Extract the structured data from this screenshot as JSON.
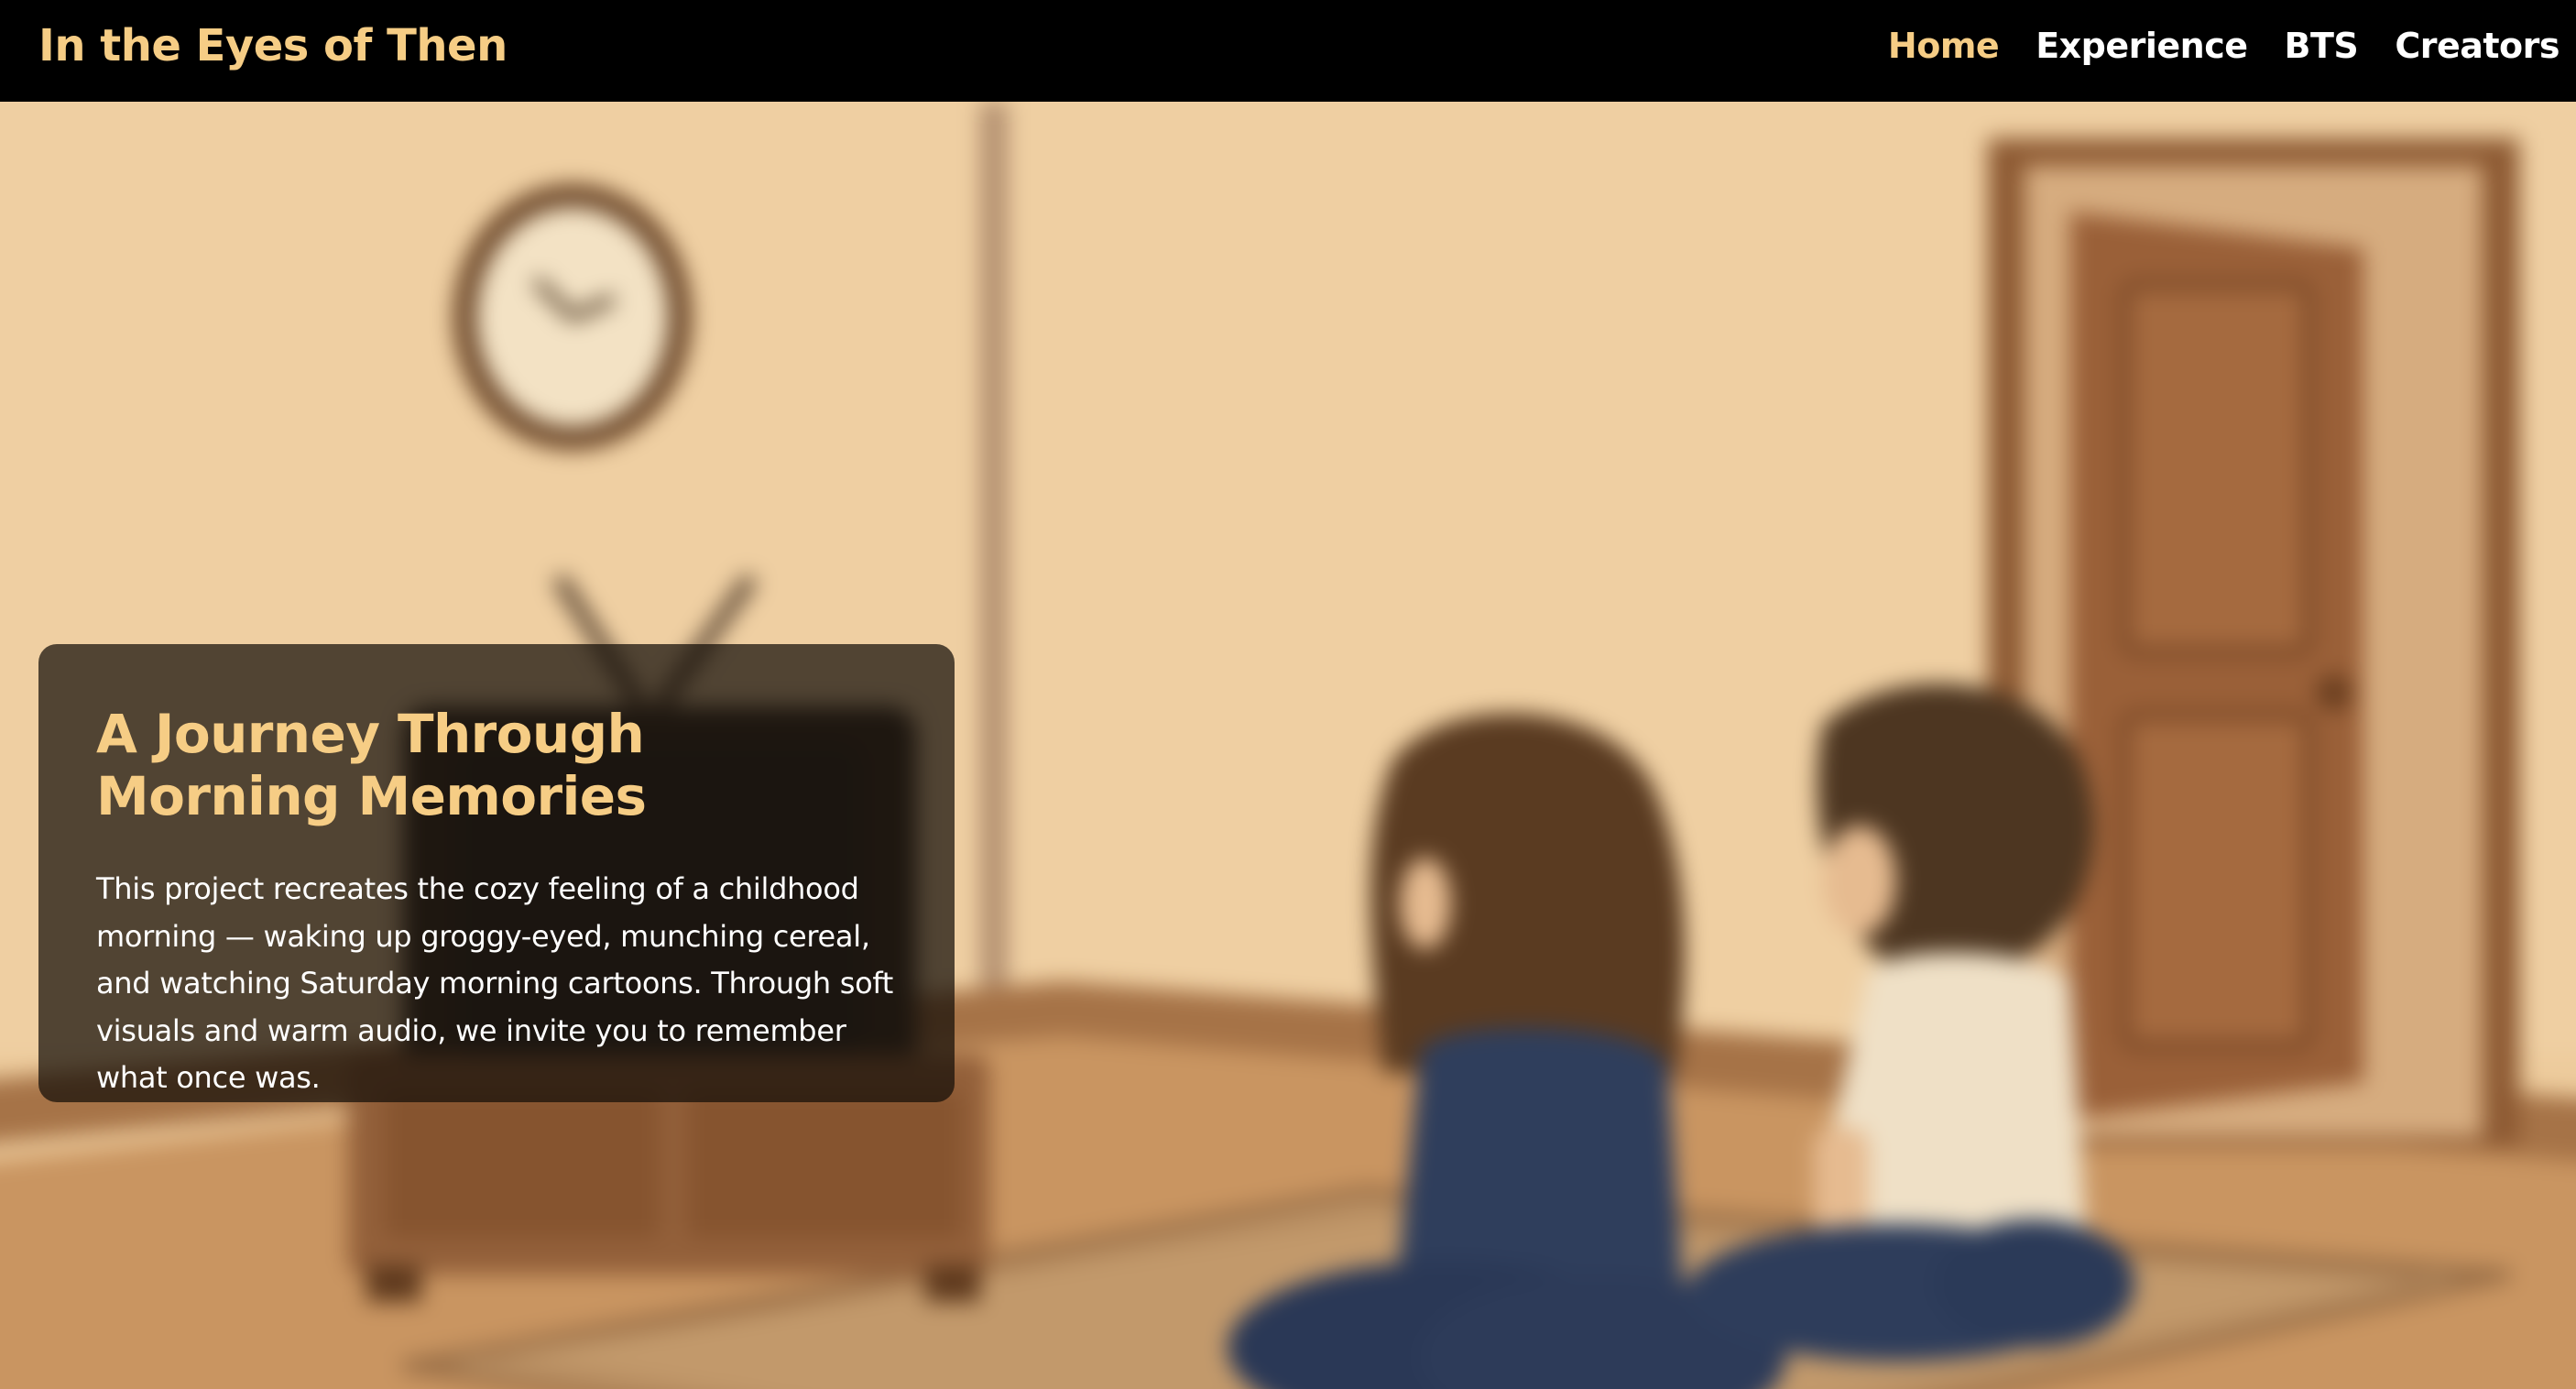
{
  "site": {
    "title": "In the Eyes of Then"
  },
  "nav": {
    "items": [
      {
        "label": "Home",
        "active": true
      },
      {
        "label": "Experience",
        "active": false
      },
      {
        "label": "BTS",
        "active": false
      },
      {
        "label": "Creators",
        "active": false
      }
    ]
  },
  "hero": {
    "heading": "A Journey Through Morning Memories",
    "description": "This project recreates the cozy feeling of a childhood morning — waking up groggy-eyed, munching cereal, and watching Saturday morning cartoons. Through soft visuals and warm audio, we invite you to remember what once was.",
    "background_scene": "blurred illustration of two children sitting on a rug watching a vintage TV in a warm-toned room with a wall clock and a wooden door"
  },
  "colors": {
    "accent": "#f6cd85",
    "nav_background": "#000000",
    "nav_text": "#ffffff",
    "card_background": "rgba(20, 14, 8, 0.72)",
    "card_text": "#ffffff"
  }
}
